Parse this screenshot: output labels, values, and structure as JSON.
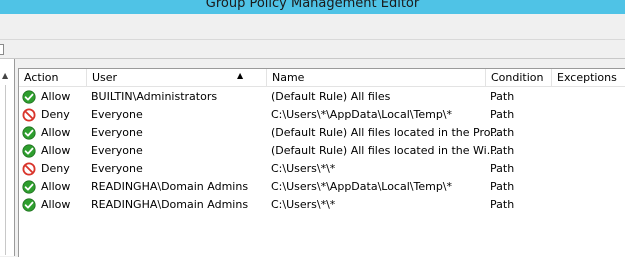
{
  "window": {
    "title": "Group Policy Management Editor"
  },
  "columns": {
    "action": "Action",
    "user": "User",
    "name": "Name",
    "condition": "Condition",
    "exceptions": "Exceptions"
  },
  "colors": {
    "titlebar": "#4fc3e6",
    "allow": "#2e9e2e",
    "deny": "#d9342b"
  },
  "rules": [
    {
      "icon": "allow-icon",
      "action": "Allow",
      "user": "BUILTIN\\Administrators",
      "name": "(Default Rule) All files",
      "condition": "Path"
    },
    {
      "icon": "deny-icon",
      "action": "Deny",
      "user": "Everyone",
      "name": "C:\\Users\\*\\AppData\\Local\\Temp\\*",
      "condition": "Path"
    },
    {
      "icon": "allow-icon",
      "action": "Allow",
      "user": "Everyone",
      "name": "(Default Rule) All files located in the Pro...",
      "condition": "Path"
    },
    {
      "icon": "allow-icon",
      "action": "Allow",
      "user": "Everyone",
      "name": "(Default Rule) All files located in the Wi...",
      "condition": "Path"
    },
    {
      "icon": "deny-icon",
      "action": "Deny",
      "user": "Everyone",
      "name": "C:\\Users\\*\\*",
      "condition": "Path"
    },
    {
      "icon": "allow-icon",
      "action": "Allow",
      "user": "READINGHA\\Domain Admins",
      "name": "C:\\Users\\*\\AppData\\Local\\Temp\\*",
      "condition": "Path"
    },
    {
      "icon": "allow-icon",
      "action": "Allow",
      "user": "READINGHA\\Domain Admins",
      "name": "C:\\Users\\*\\*",
      "condition": "Path"
    }
  ]
}
